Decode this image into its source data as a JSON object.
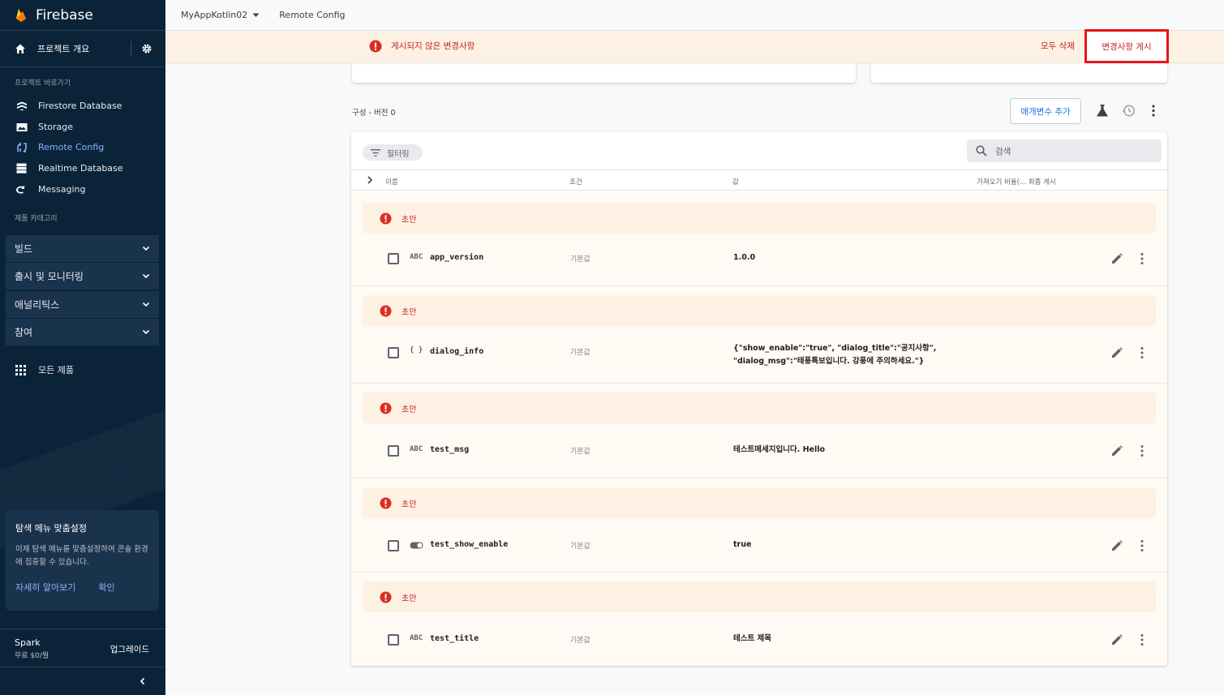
{
  "sidebar": {
    "brand": "Firebase",
    "overview": "프로젝트 개요",
    "shortcuts_title": "프로젝트 바로가기",
    "shortcuts": [
      {
        "label": "Firestore Database",
        "icon": "firestore-icon"
      },
      {
        "label": "Storage",
        "icon": "storage-icon"
      },
      {
        "label": "Remote Config",
        "icon": "remote-config-icon",
        "active": true
      },
      {
        "label": "Realtime Database",
        "icon": "realtime-database-icon"
      },
      {
        "label": "Messaging",
        "icon": "messaging-icon"
      }
    ],
    "categories_title": "제품 카테고리",
    "categories": [
      "빌드",
      "출시 및 모니터링",
      "애널리틱스",
      "참여"
    ],
    "all_products": "모든 제품",
    "promo": {
      "title": "탐색 메뉴 맞춤설정",
      "desc": "이제 탐색 메뉴를 맞춤설정하여 콘솔 환경에 집중할 수 있습니다.",
      "learn_more": "자세히 알아보기",
      "confirm": "확인"
    },
    "plan": {
      "name": "Spark",
      "price": "무료 $0/월",
      "upgrade": "업그레이드"
    }
  },
  "topbar": {
    "project": "MyAppKotlin02",
    "page": "Remote Config"
  },
  "banner": {
    "message": "게시되지 않은 변경사항",
    "discard_all": "모두 삭제",
    "publish": "변경사항 게시"
  },
  "toolbar": {
    "version_label": "구성 - 버전",
    "version_number": "0",
    "add_param": "매개변수 추가"
  },
  "table": {
    "filter": "필터링",
    "search_placeholder": "검색",
    "headers": {
      "name": "이름",
      "condition": "조건",
      "value": "값",
      "fetch": "가져오기 비율(... 최종 게시"
    },
    "draft_label": "초안",
    "rows": [
      {
        "type": "ABC",
        "name": "app_version",
        "condition": "기본값",
        "value": "1.0.0"
      },
      {
        "type": "{ }",
        "name": "dialog_info",
        "condition": "기본값",
        "value_line1": "{\"show_enable\":\"true\", \"dialog_title\":\"공지사항\",",
        "value_line2": "\"dialog_msg\":\"태풍특보입니다. 강풍에 주의하세요.\"}"
      },
      {
        "type": "ABC",
        "name": "test_msg",
        "condition": "기본값",
        "value": "테스트메세지입니다. Hello"
      },
      {
        "type": "toggle",
        "name": "test_show_enable",
        "condition": "기본값",
        "value": "true"
      },
      {
        "type": "ABC",
        "name": "test_title",
        "condition": "기본값",
        "value": "테스트 제목"
      }
    ]
  },
  "colors": {
    "sidebar": "#0b2339",
    "accent": "#1a73e8",
    "warning": "#c5221f",
    "banner": "#fdf1e4",
    "highlight": "#e8141c"
  }
}
